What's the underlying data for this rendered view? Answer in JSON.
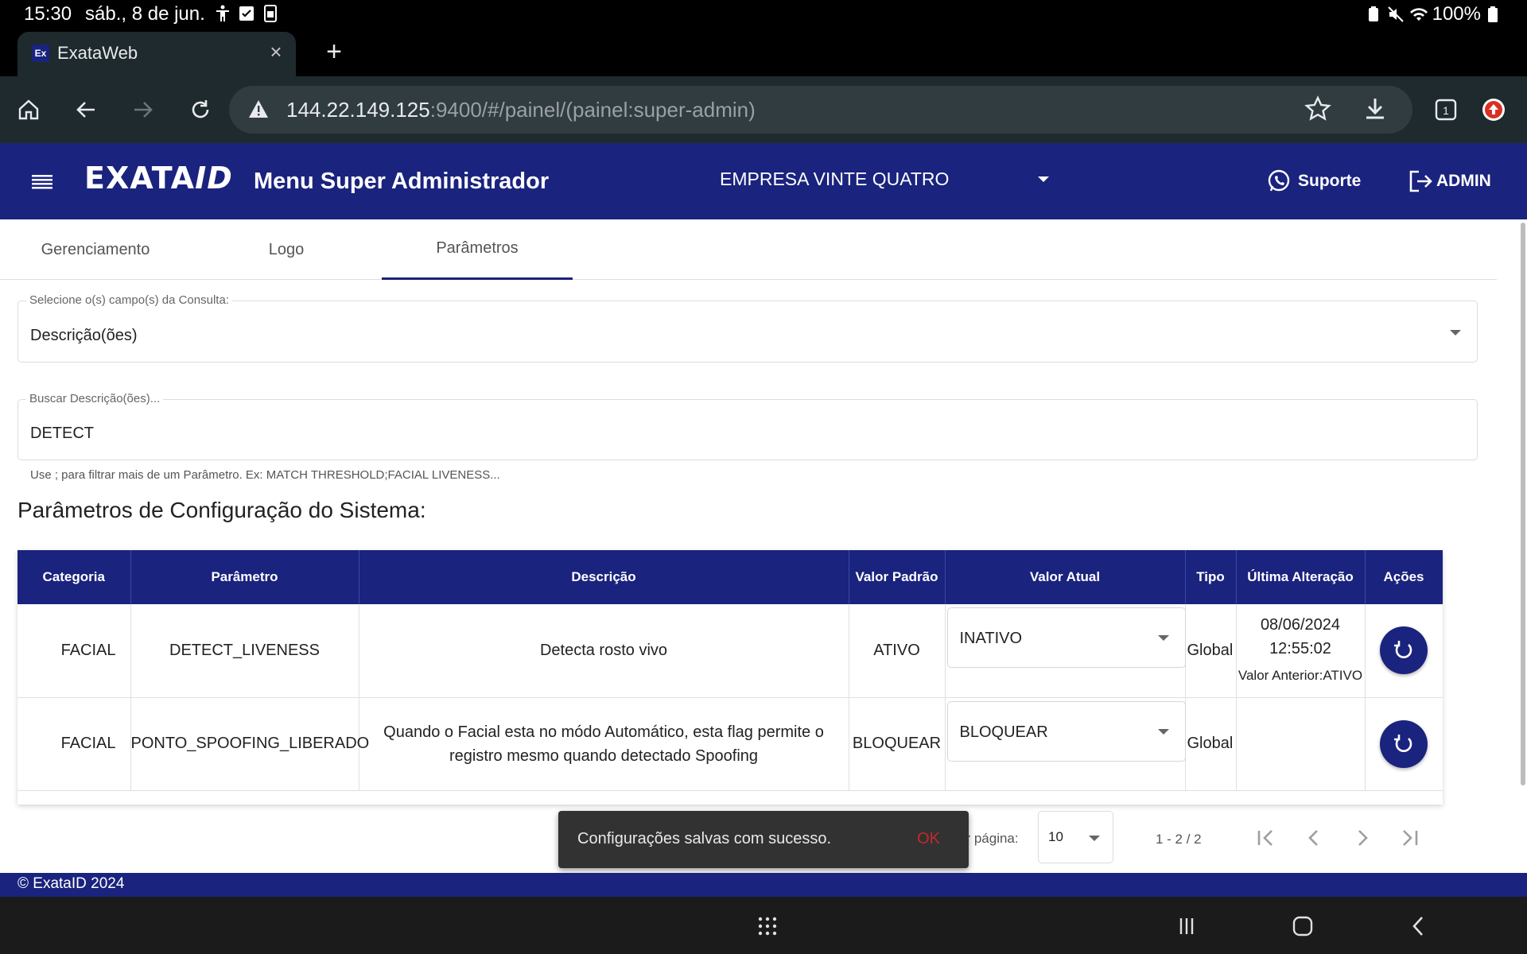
{
  "status_bar": {
    "time": "15:30",
    "date": "sáb., 8 de jun.",
    "battery": "100%"
  },
  "browser": {
    "tab_title": "ExataWeb",
    "favicon_text": "Ex",
    "url_main": "144.22.149.125",
    "url_rest": ":9400/#/painel/(painel:super-admin)",
    "tab_count": "1"
  },
  "header": {
    "logo_main": "EXATA",
    "logo_suffix": "ID",
    "title": "Menu Super Administrador",
    "company": "EMPRESA VINTE QUATRO",
    "support_label": "Suporte",
    "admin_label": "ADMIN"
  },
  "tabs": [
    {
      "label": "Gerenciamento"
    },
    {
      "label": "Logo"
    },
    {
      "label": "Parâmetros"
    }
  ],
  "query_field": {
    "label": "Selecione o(s) campo(s) da Consulta:",
    "value": "Descrição(ões)"
  },
  "search_field": {
    "label": "Buscar Descrição(ões)...",
    "value": "DETECT"
  },
  "hint": "Use ; para filtrar mais de um Parâmetro. Ex: MATCH THRESHOLD;FACIAL LIVENESS...",
  "section_title": "Parâmetros de Configuração do Sistema:",
  "table": {
    "headers": [
      "Categoria",
      "Parâmetro",
      "Descrição",
      "Valor Padrão",
      "Valor Atual",
      "Tipo",
      "Última Alteração",
      "Ações"
    ],
    "rows": [
      {
        "categoria": "FACIAL",
        "parametro": "DETECT_LIVENESS",
        "descricao": "Detecta rosto vivo",
        "padrao": "ATIVO",
        "atual": "INATIVO",
        "tipo": "Global",
        "alt_data": "08/06/2024",
        "alt_hora": "12:55:02",
        "alt_prev": "Valor Anterior:ATIVO"
      },
      {
        "categoria": "FACIAL",
        "parametro": "PONTO_SPOOFING_LIBERADO",
        "descricao": "Quando o Facial esta no módo Automático, esta flag permite o registro mesmo quando detectado Spoofing",
        "padrao": "BLOQUEAR",
        "atual": "BLOQUEAR",
        "tipo": "Global",
        "alt_data": "",
        "alt_hora": "",
        "alt_prev": ""
      }
    ]
  },
  "paginator": {
    "per_page_label": "or página:",
    "per_page_value": "10",
    "range": "1 - 2 / 2"
  },
  "snackbar": {
    "message": "Configurações salvas com sucesso.",
    "action": "OK"
  },
  "footer": "© ExataID 2024",
  "colors": {
    "primary": "#1a237e",
    "snackbar": "#323232",
    "snack_action": "#c62828"
  }
}
